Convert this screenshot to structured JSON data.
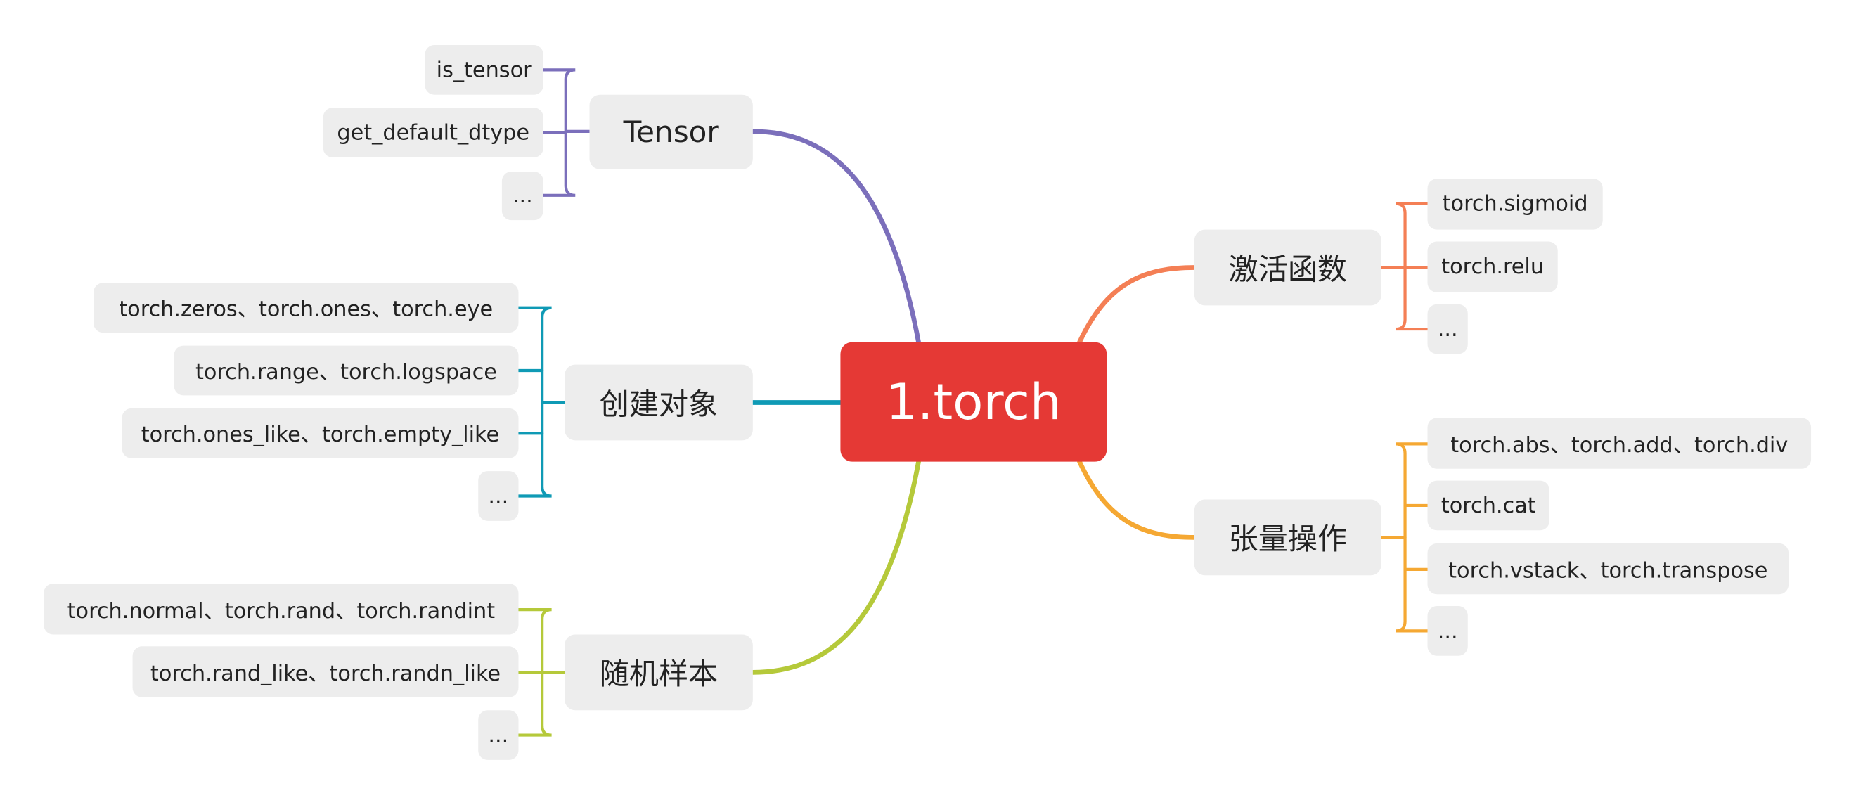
{
  "center": {
    "label": "1.torch",
    "color": "#E53935"
  },
  "branches": {
    "tensor": {
      "label": "Tensor",
      "color": "#7B6FBB",
      "children": [
        "is_tensor",
        "get_default_dtype",
        "..."
      ]
    },
    "create": {
      "label": "创建对象",
      "color": "#0F9AB5",
      "children": [
        "torch.zeros、torch.ones、torch.eye",
        "torch.range、torch.logspace",
        "torch.ones_like、torch.empty_like",
        "..."
      ]
    },
    "random": {
      "label": "随机样本",
      "color": "#B5C93A",
      "children": [
        "torch.normal、torch.rand、torch.randint",
        "torch.rand_like、torch.randn_like",
        "..."
      ]
    },
    "activation": {
      "label": "激活函数",
      "color": "#F47F55",
      "children": [
        "torch.sigmoid",
        "torch.relu",
        "..."
      ]
    },
    "tensor_ops": {
      "label": "张量操作",
      "color": "#F5A833",
      "children": [
        "torch.abs、torch.add、torch.div",
        "torch.cat",
        "torch.vstack、torch.transpose",
        "..."
      ]
    }
  }
}
